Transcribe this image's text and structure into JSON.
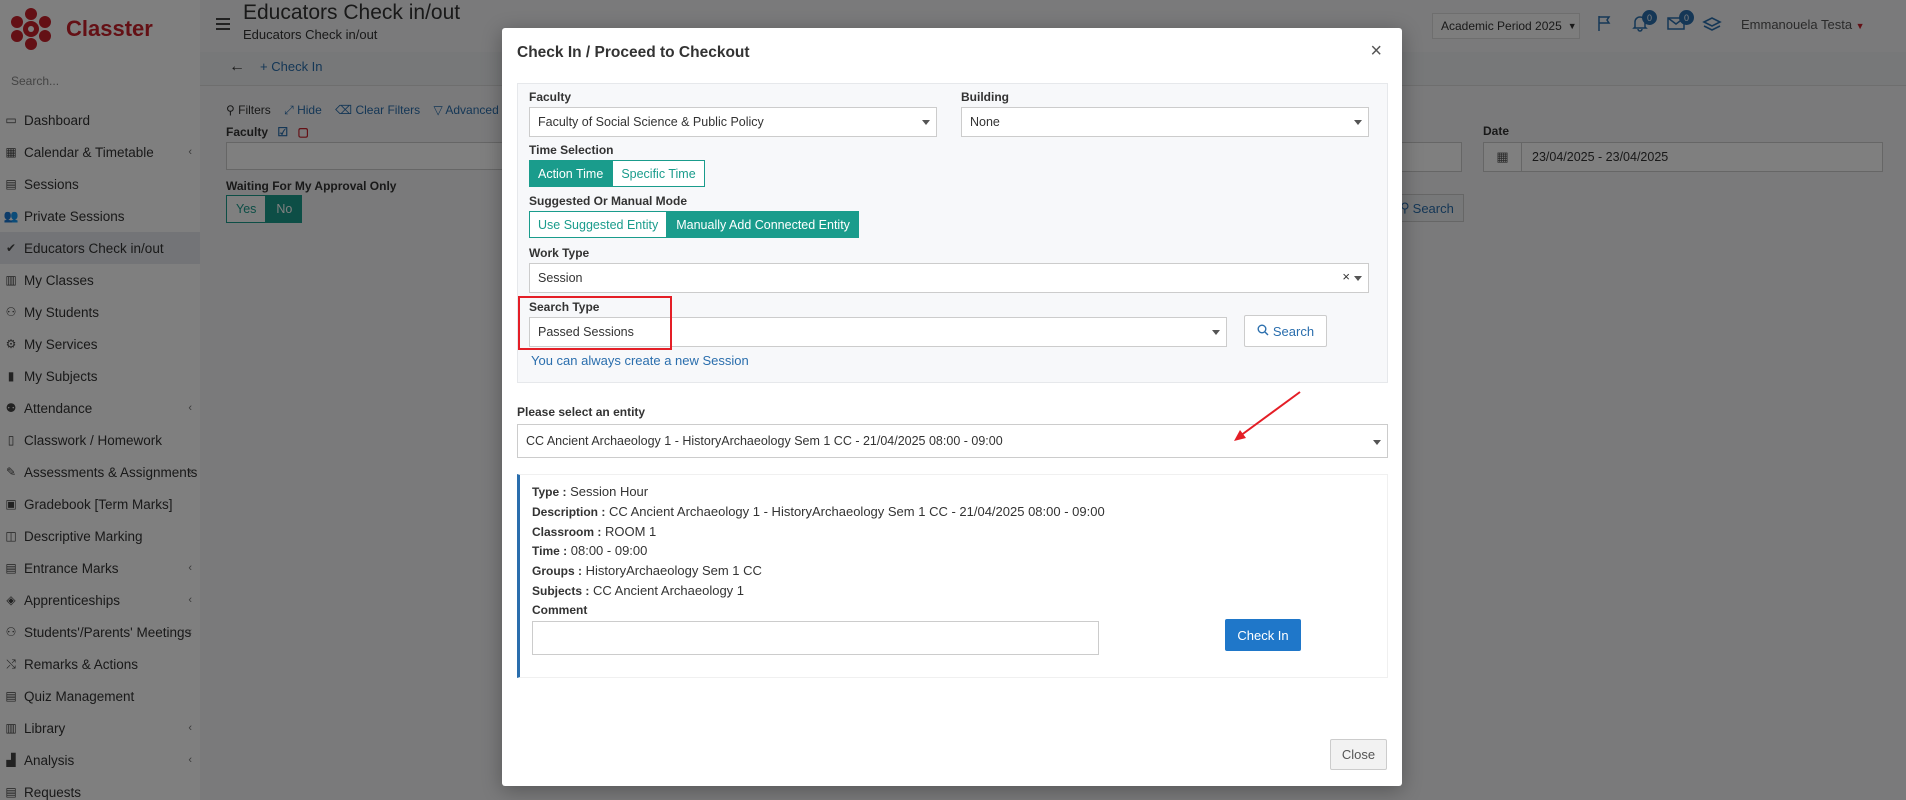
{
  "app": {
    "brand": "Classter",
    "search_placeholder": "Search...",
    "page_title": "Educators Check in/out",
    "page_subtitle": "Educators Check in/out",
    "academic_period": "Academic Period 2025",
    "notifications_count": "0",
    "messages_count": "0",
    "user_name": "Emmanouela Testa"
  },
  "sidebar": {
    "items": [
      {
        "label": "Dashboard",
        "icon": "monitor-icon",
        "chev": ""
      },
      {
        "label": "Calendar & Timetable",
        "icon": "calendar-icon",
        "chev": "‹"
      },
      {
        "label": "Sessions",
        "icon": "calendar-grid-icon",
        "chev": ""
      },
      {
        "label": "Private Sessions",
        "icon": "users-icon",
        "chev": ""
      },
      {
        "label": "Educators Check in/out",
        "icon": "check-icon",
        "chev": ""
      },
      {
        "label": "My Classes",
        "icon": "classroom-icon",
        "chev": ""
      },
      {
        "label": "My Students",
        "icon": "students-icon",
        "chev": ""
      },
      {
        "label": "My Services",
        "icon": "services-icon",
        "chev": ""
      },
      {
        "label": "My Subjects",
        "icon": "books-icon",
        "chev": ""
      },
      {
        "label": "Attendance",
        "icon": "attendance-icon",
        "chev": "‹"
      },
      {
        "label": "Classwork / Homework",
        "icon": "homework-icon",
        "chev": ""
      },
      {
        "label": "Assessments & Assignments",
        "icon": "edit-icon",
        "chev": "‹"
      },
      {
        "label": "Gradebook [Term Marks]",
        "icon": "gradebook-icon",
        "chev": ""
      },
      {
        "label": "Descriptive Marking",
        "icon": "marking-icon",
        "chev": ""
      },
      {
        "label": "Entrance Marks",
        "icon": "entrance-icon",
        "chev": "‹"
      },
      {
        "label": "Apprenticeships",
        "icon": "box-icon",
        "chev": "‹"
      },
      {
        "label": "Students'/Parents' Meetings",
        "icon": "meetings-icon",
        "chev": "‹"
      },
      {
        "label": "Remarks & Actions",
        "icon": "remarks-icon",
        "chev": ""
      },
      {
        "label": "Quiz Management",
        "icon": "quiz-icon",
        "chev": ""
      },
      {
        "label": "Library",
        "icon": "library-icon",
        "chev": "‹"
      },
      {
        "label": "Analysis",
        "icon": "analysis-icon",
        "chev": "‹"
      },
      {
        "label": "Requests",
        "icon": "requests-icon",
        "chev": ""
      }
    ]
  },
  "background": {
    "check_in_link": "Check In",
    "filters": "Filters",
    "hide": "Hide",
    "clear_filters": "Clear Filters",
    "advanced": "Advanced F",
    "faculty_label": "Faculty",
    "date_label": "Date",
    "date_value": "23/04/2025 - 23/04/2025",
    "waiting_label": "Waiting For My Approval Only",
    "yes": "Yes",
    "no": "No",
    "search": "Search"
  },
  "modal": {
    "title": "Check In / Proceed to Checkout",
    "faculty_label": "Faculty",
    "faculty_value": "Faculty of Social Science & Public Policy",
    "building_label": "Building",
    "building_value": "None",
    "time_selection_label": "Time Selection",
    "action_time": "Action Time",
    "specific_time": "Specific Time",
    "mode_label": "Suggested Or Manual Mode",
    "use_suggested": "Use Suggested Entity",
    "manually_add": "Manually Add Connected Entity",
    "work_type_label": "Work Type",
    "work_type_value": "Session",
    "search_type_label": "Search Type",
    "search_type_value": "Passed Sessions",
    "search_button": "Search",
    "create_link": "You can always create a new Session",
    "entity_label": "Please select an entity",
    "entity_value": "CC Ancient Archaeology 1 - HistoryArchaeology Sem 1 CC - 21/04/2025 08:00 - 09:00",
    "details": {
      "type_label": "Type :",
      "type_value": "Session Hour",
      "description_label": "Description :",
      "description_value": "CC Ancient Archaeology 1 - HistoryArchaeology Sem 1 CC - 21/04/2025 08:00 - 09:00",
      "classroom_label": "Classroom :",
      "classroom_value": "ROOM 1",
      "time_label": "Time :",
      "time_value": "08:00 - 09:00",
      "groups_label": "Groups :",
      "groups_value": "HistoryArchaeology Sem 1 CC",
      "subjects_label": "Subjects :",
      "subjects_value": "CC Ancient Archaeology 1",
      "comment_label": "Comment"
    },
    "check_in_button": "Check In",
    "close_button": "Close"
  },
  "colors": {
    "brand_red": "#c8202a",
    "teal": "#1a9c8c",
    "primary_blue": "#1f77c9",
    "link_blue": "#2a6ead",
    "highlight_red": "#e41e26"
  }
}
